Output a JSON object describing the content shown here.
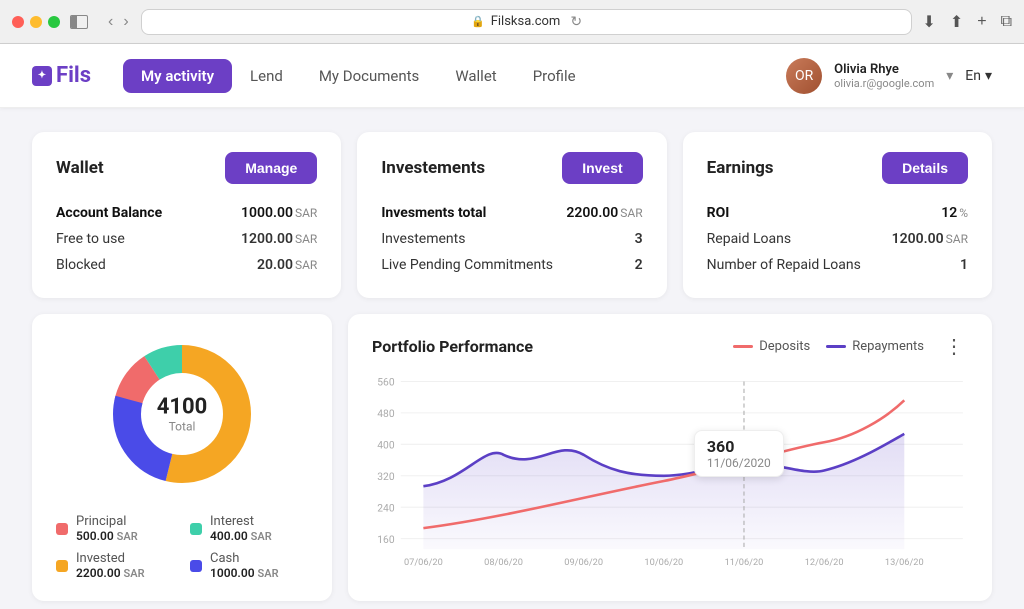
{
  "browser": {
    "url": "Filsksa.com"
  },
  "header": {
    "logo_text": "Fils",
    "nav_items": [
      {
        "label": "My activity",
        "active": true
      },
      {
        "label": "Lend",
        "active": false
      },
      {
        "label": "My Documents",
        "active": false
      },
      {
        "label": "Wallet",
        "active": false
      },
      {
        "label": "Profile",
        "active": false
      }
    ],
    "user_name": "Olivia Rhye",
    "user_email": "olivia.r@google.com",
    "lang": "En"
  },
  "wallet_card": {
    "title": "Wallet",
    "btn_label": "Manage",
    "rows": [
      {
        "label": "Account Balance",
        "value": "1000.00",
        "unit": "SAR",
        "bold": true
      },
      {
        "label": "Free to use",
        "value": "1200.00",
        "unit": "SAR",
        "bold": false
      },
      {
        "label": "Blocked",
        "value": "20.00",
        "unit": "SAR",
        "bold": false
      }
    ]
  },
  "investments_card": {
    "title": "Investements",
    "btn_label": "Invest",
    "rows": [
      {
        "label": "Invesments total",
        "value": "2200.00",
        "unit": "SAR",
        "bold": true
      },
      {
        "label": "Investements",
        "value": "3",
        "unit": "",
        "bold": false
      },
      {
        "label": "Live Pending Commitments",
        "value": "2",
        "unit": "",
        "bold": false
      }
    ]
  },
  "earnings_card": {
    "title": "Earnings",
    "btn_label": "Details",
    "rows": [
      {
        "label": "ROI",
        "value": "12",
        "unit": "%",
        "bold": true
      },
      {
        "label": "Repaid Loans",
        "value": "1200.00",
        "unit": "SAR",
        "bold": false
      },
      {
        "label": "Number of Repaid Loans",
        "value": "1",
        "unit": "",
        "bold": false
      }
    ]
  },
  "donut": {
    "total": "4100",
    "total_label": "Total",
    "segments": [
      {
        "label": "Principal",
        "value": "500.00",
        "unit": "SAR",
        "color": "#f06b6b"
      },
      {
        "label": "Interest",
        "value": "400.00",
        "unit": "SAR",
        "color": "#3ecfaa"
      },
      {
        "label": "Invested",
        "value": "2200.00",
        "unit": "SAR",
        "color": "#f5a623"
      },
      {
        "label": "Cash",
        "value": "1000.00",
        "unit": "SAR",
        "color": "#4a4be8"
      }
    ]
  },
  "chart": {
    "title": "Portfolio Performance",
    "legend": [
      {
        "label": "Deposits",
        "color": "#f06b6b"
      },
      {
        "label": "Repayments",
        "color": "#5b3fc5"
      }
    ],
    "y_labels": [
      "560",
      "480",
      "400",
      "320",
      "240",
      "160"
    ],
    "x_labels": [
      "07/06/20",
      "08/06/20",
      "09/06/20",
      "10/06/20",
      "11/06/20",
      "12/06/20",
      "13/06/20"
    ],
    "tooltip": {
      "value": "360",
      "date": "11/06/2020"
    }
  }
}
